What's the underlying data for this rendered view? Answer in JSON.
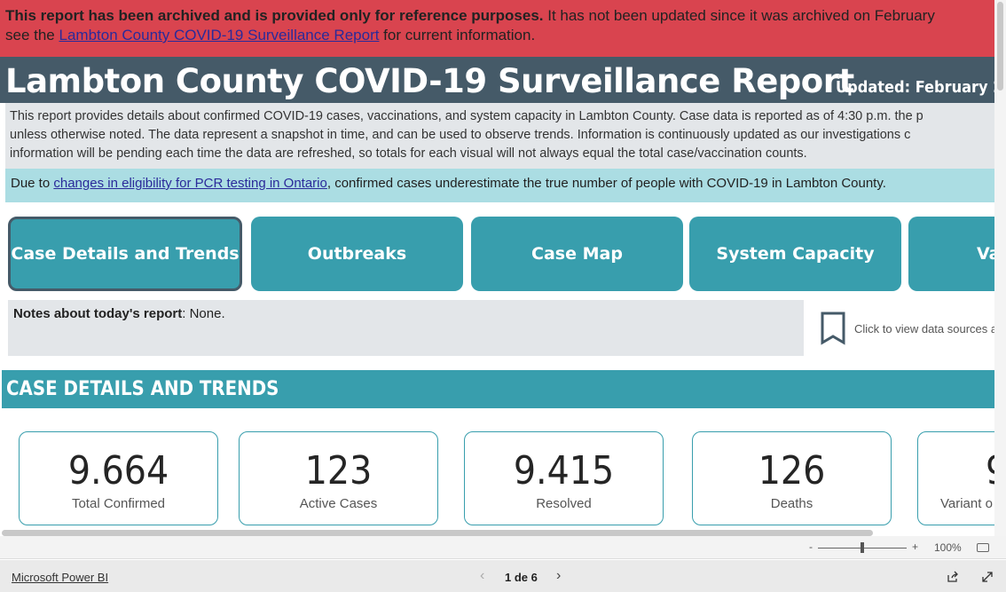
{
  "banner": {
    "bold": "This report has been archived and is provided only for reference purposes.",
    "text1": " It has not been updated since it was archived on February",
    "text2": "see the ",
    "link": "Lambton County COVID-19 Surveillance Report",
    "text3": " for current information."
  },
  "header": {
    "title": "Lambton County COVID-19 Surveillance Report",
    "updated": "Updated: February 2"
  },
  "description": [
    "This report provides details about confirmed COVID-19 cases, vaccinations, and system capacity in Lambton County. Case data is reported as of 4:30 p.m. the p",
    "unless otherwise noted. The data represent a snapshot in time, and can be used to observe trends. Information is continuously updated as our investigations c",
    "information will be pending each time the data are refreshed, so totals for each visual will not always equal the total case/vaccination counts."
  ],
  "pcr": {
    "pre": "Due to ",
    "link": "changes in eligibility for PCR testing in Ontario",
    "post": ", confirmed cases underestimate the true number of people with COVID-19 in Lambton County."
  },
  "nav": [
    "Case Details and Trends",
    "Outbreaks",
    "Case Map",
    "System Capacity",
    "Va"
  ],
  "notes": {
    "label": "Notes about today's report",
    "text": ": None."
  },
  "data_sources": "Click to view data sources a",
  "section_title": "CASE DETAILS AND TRENDS",
  "cards": [
    {
      "value": "9.664",
      "label": "Total Confirmed"
    },
    {
      "value": "123",
      "label": "Active Cases"
    },
    {
      "value": "9.415",
      "label": "Resolved"
    },
    {
      "value": "126",
      "label": "Deaths"
    },
    {
      "value": "9",
      "label": "Variant o"
    }
  ],
  "zoom": {
    "minus": "-",
    "plus": "+",
    "level": "100%",
    "slider_percent": 50
  },
  "footer": {
    "brand": "Microsoft Power BI",
    "page": "1 de 6"
  },
  "colors": {
    "banner": "#d9444f",
    "header": "#455a68",
    "accent": "#389ead"
  }
}
